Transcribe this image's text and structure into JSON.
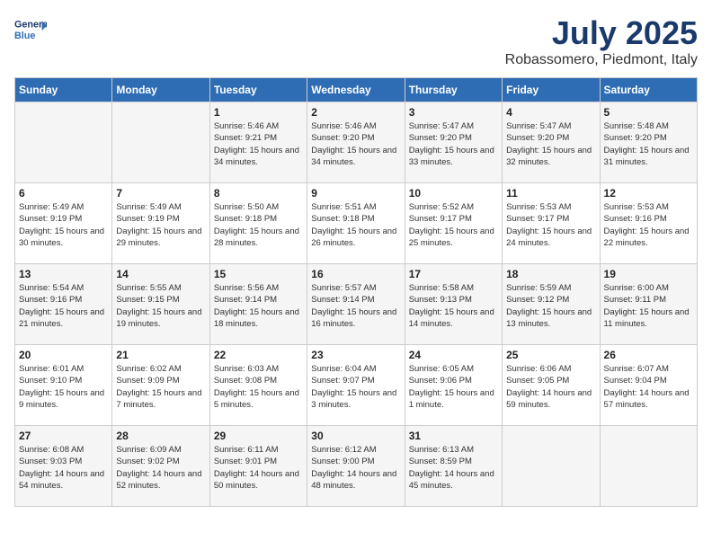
{
  "logo": {
    "line1": "General",
    "line2": "Blue"
  },
  "title": "July 2025",
  "location": "Robassomero, Piedmont, Italy",
  "days_of_week": [
    "Sunday",
    "Monday",
    "Tuesday",
    "Wednesday",
    "Thursday",
    "Friday",
    "Saturday"
  ],
  "weeks": [
    [
      {
        "day": "",
        "info": ""
      },
      {
        "day": "",
        "info": ""
      },
      {
        "day": "1",
        "info": "Sunrise: 5:46 AM\nSunset: 9:21 PM\nDaylight: 15 hours and 34 minutes."
      },
      {
        "day": "2",
        "info": "Sunrise: 5:46 AM\nSunset: 9:20 PM\nDaylight: 15 hours and 34 minutes."
      },
      {
        "day": "3",
        "info": "Sunrise: 5:47 AM\nSunset: 9:20 PM\nDaylight: 15 hours and 33 minutes."
      },
      {
        "day": "4",
        "info": "Sunrise: 5:47 AM\nSunset: 9:20 PM\nDaylight: 15 hours and 32 minutes."
      },
      {
        "day": "5",
        "info": "Sunrise: 5:48 AM\nSunset: 9:20 PM\nDaylight: 15 hours and 31 minutes."
      }
    ],
    [
      {
        "day": "6",
        "info": "Sunrise: 5:49 AM\nSunset: 9:19 PM\nDaylight: 15 hours and 30 minutes."
      },
      {
        "day": "7",
        "info": "Sunrise: 5:49 AM\nSunset: 9:19 PM\nDaylight: 15 hours and 29 minutes."
      },
      {
        "day": "8",
        "info": "Sunrise: 5:50 AM\nSunset: 9:18 PM\nDaylight: 15 hours and 28 minutes."
      },
      {
        "day": "9",
        "info": "Sunrise: 5:51 AM\nSunset: 9:18 PM\nDaylight: 15 hours and 26 minutes."
      },
      {
        "day": "10",
        "info": "Sunrise: 5:52 AM\nSunset: 9:17 PM\nDaylight: 15 hours and 25 minutes."
      },
      {
        "day": "11",
        "info": "Sunrise: 5:53 AM\nSunset: 9:17 PM\nDaylight: 15 hours and 24 minutes."
      },
      {
        "day": "12",
        "info": "Sunrise: 5:53 AM\nSunset: 9:16 PM\nDaylight: 15 hours and 22 minutes."
      }
    ],
    [
      {
        "day": "13",
        "info": "Sunrise: 5:54 AM\nSunset: 9:16 PM\nDaylight: 15 hours and 21 minutes."
      },
      {
        "day": "14",
        "info": "Sunrise: 5:55 AM\nSunset: 9:15 PM\nDaylight: 15 hours and 19 minutes."
      },
      {
        "day": "15",
        "info": "Sunrise: 5:56 AM\nSunset: 9:14 PM\nDaylight: 15 hours and 18 minutes."
      },
      {
        "day": "16",
        "info": "Sunrise: 5:57 AM\nSunset: 9:14 PM\nDaylight: 15 hours and 16 minutes."
      },
      {
        "day": "17",
        "info": "Sunrise: 5:58 AM\nSunset: 9:13 PM\nDaylight: 15 hours and 14 minutes."
      },
      {
        "day": "18",
        "info": "Sunrise: 5:59 AM\nSunset: 9:12 PM\nDaylight: 15 hours and 13 minutes."
      },
      {
        "day": "19",
        "info": "Sunrise: 6:00 AM\nSunset: 9:11 PM\nDaylight: 15 hours and 11 minutes."
      }
    ],
    [
      {
        "day": "20",
        "info": "Sunrise: 6:01 AM\nSunset: 9:10 PM\nDaylight: 15 hours and 9 minutes."
      },
      {
        "day": "21",
        "info": "Sunrise: 6:02 AM\nSunset: 9:09 PM\nDaylight: 15 hours and 7 minutes."
      },
      {
        "day": "22",
        "info": "Sunrise: 6:03 AM\nSunset: 9:08 PM\nDaylight: 15 hours and 5 minutes."
      },
      {
        "day": "23",
        "info": "Sunrise: 6:04 AM\nSunset: 9:07 PM\nDaylight: 15 hours and 3 minutes."
      },
      {
        "day": "24",
        "info": "Sunrise: 6:05 AM\nSunset: 9:06 PM\nDaylight: 15 hours and 1 minute."
      },
      {
        "day": "25",
        "info": "Sunrise: 6:06 AM\nSunset: 9:05 PM\nDaylight: 14 hours and 59 minutes."
      },
      {
        "day": "26",
        "info": "Sunrise: 6:07 AM\nSunset: 9:04 PM\nDaylight: 14 hours and 57 minutes."
      }
    ],
    [
      {
        "day": "27",
        "info": "Sunrise: 6:08 AM\nSunset: 9:03 PM\nDaylight: 14 hours and 54 minutes."
      },
      {
        "day": "28",
        "info": "Sunrise: 6:09 AM\nSunset: 9:02 PM\nDaylight: 14 hours and 52 minutes."
      },
      {
        "day": "29",
        "info": "Sunrise: 6:11 AM\nSunset: 9:01 PM\nDaylight: 14 hours and 50 minutes."
      },
      {
        "day": "30",
        "info": "Sunrise: 6:12 AM\nSunset: 9:00 PM\nDaylight: 14 hours and 48 minutes."
      },
      {
        "day": "31",
        "info": "Sunrise: 6:13 AM\nSunset: 8:59 PM\nDaylight: 14 hours and 45 minutes."
      },
      {
        "day": "",
        "info": ""
      },
      {
        "day": "",
        "info": ""
      }
    ]
  ]
}
